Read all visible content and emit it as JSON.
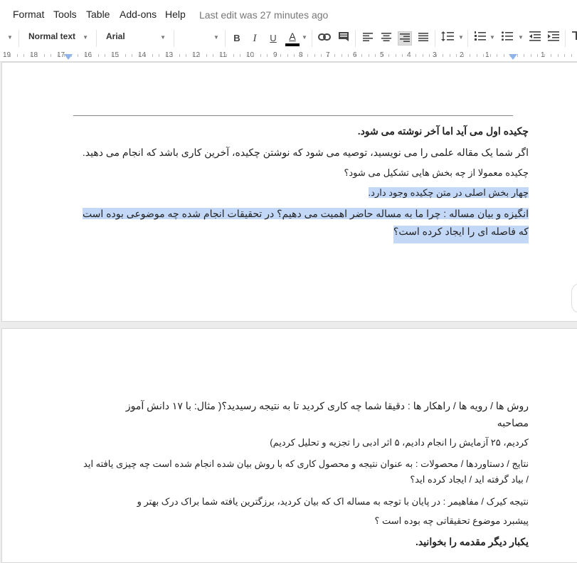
{
  "menu": {
    "items": [
      "Format",
      "Tools",
      "Table",
      "Add-ons",
      "Help"
    ],
    "last_edit": "Last edit was 27 minutes ago"
  },
  "toolbar": {
    "style_value": "Normal text",
    "font_value": "Arial",
    "bold": "B",
    "italic": "I",
    "underline": "U",
    "text_color": "A",
    "text_color_hex": "#000000"
  },
  "ruler": {
    "numbers": [
      "19",
      "18",
      "17",
      "16",
      "15",
      "14",
      "13",
      "12",
      "11",
      "10",
      "9",
      "8",
      "7",
      "6",
      "5",
      "4",
      "3",
      "2",
      "1",
      "1"
    ]
  },
  "page1": {
    "lines": [
      "چکیده اول می آید اما آخر نوشته می شود.",
      "اگر شما یک مقاله علمی را می نویسید، توصیه می شود که نوشتن چکیده، آخرین کاری باشد که انجام می دهید.",
      "چکیده معمولا از چه بخش هایی تشکیل می شود؟",
      "چهار بخش اصلی در متن چکیده وجود دارد.",
      "انگیزه و بیان مساله : چرا ما به مساله حاضر اهمیت می دهیم؟ در تحقیقات انجام شده چه موضوعی بوده است",
      "که فاصله ای را ایجاد کرده است؟"
    ]
  },
  "page2": {
    "lines": [
      "روش ها / رویه ها / راهکار ها : دقیقا شما چه کاری کردید تا به نتیجه رسیدید؟( مثال: با ۱۷ دانش آموز",
      "مصاحبه",
      "کردیم، ۲۵ آزمایش را انجام دادیم، ۵ اثر ادبی را تجزیه و تحلیل کردیم)",
      "نتایج / دستاوردها / محصولات : به عنوان نتیجه و محصول کاری که با روش بیان شده انجام شده است چه چیزی یافته اید",
      "/ بیاد گرفته اید / ایجاد کرده اید؟",
      "نتیجه کیرک / مفاهیمر : در پایان با توجه به مساله اک که بیان کردید، برزگترین یافته شما براک درک بهتر و",
      "پیشبرد موضوع تحقیقاتی چه بوده است ؟",
      "یکبار دیگر مقدمه را بخوانید."
    ]
  }
}
